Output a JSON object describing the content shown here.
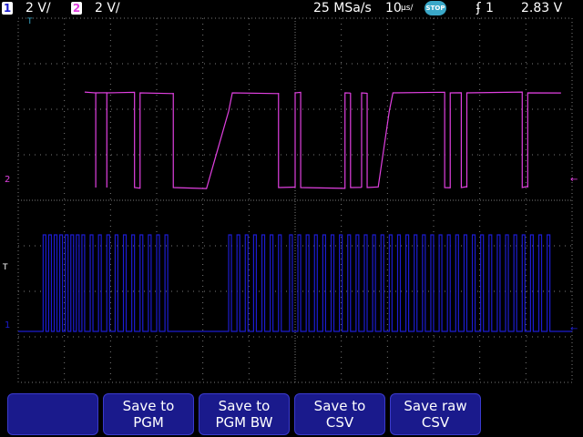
{
  "status": {
    "ch1_number": "1",
    "ch1_scale": "2 V/",
    "ch2_number": "2",
    "ch2_scale": "2 V/",
    "sample_rate": "25 MSa/s",
    "timebase": "10",
    "timebase_unit": "µs/",
    "run_state": "STOP",
    "trigger_channel": "1",
    "trigger_level": "2.83 V"
  },
  "markers": {
    "top_marker": "T",
    "ch2_marker": "2",
    "trig_marker": "T",
    "ch1_marker": "1"
  },
  "softkeys": [
    {
      "line1": "",
      "line2": ""
    },
    {
      "line1": "Save to",
      "line2": "PGM"
    },
    {
      "line1": "Save to",
      "line2": "PGM BW"
    },
    {
      "line1": "Save to",
      "line2": "CSV"
    },
    {
      "line1": "Save raw",
      "line2": "CSV"
    }
  ],
  "colors": {
    "ch1": "#1c1cd0",
    "ch2": "#e040e0",
    "grid": "#7a7a7a",
    "softkey_bg": "#1a1a8c"
  },
  "traces": {
    "ch2_segments": [
      [
        "h",
        0.12
      ],
      [
        "d",
        0.14
      ],
      [
        "l",
        0.14
      ],
      [
        "u",
        0.14
      ],
      [
        "h",
        0.16
      ],
      [
        "d",
        0.16
      ],
      [
        "l",
        0.16
      ],
      [
        "u",
        0.16
      ],
      [
        "h",
        0.21
      ],
      [
        "d",
        0.21
      ],
      [
        "l",
        0.22
      ],
      [
        "u",
        0.22
      ],
      [
        "h",
        0.28
      ],
      [
        "d",
        0.28
      ],
      [
        "l",
        0.34
      ],
      [
        "r",
        0.38
      ],
      [
        "h",
        0.47
      ],
      [
        "d",
        0.47
      ],
      [
        "l",
        0.5
      ],
      [
        "u",
        0.5
      ],
      [
        "h",
        0.51
      ],
      [
        "d",
        0.51
      ],
      [
        "l",
        0.59
      ],
      [
        "u",
        0.59
      ],
      [
        "h",
        0.6
      ],
      [
        "d",
        0.6
      ],
      [
        "l",
        0.62
      ],
      [
        "u",
        0.62
      ],
      [
        "h",
        0.63
      ],
      [
        "d",
        0.63
      ],
      [
        "l",
        0.65
      ],
      [
        "r",
        0.67
      ],
      [
        "h",
        0.77
      ],
      [
        "d",
        0.77
      ],
      [
        "l",
        0.78
      ],
      [
        "u",
        0.78
      ],
      [
        "h",
        0.8
      ],
      [
        "d",
        0.8
      ],
      [
        "l",
        0.81
      ],
      [
        "u",
        0.81
      ],
      [
        "h",
        0.91
      ],
      [
        "d",
        0.91
      ],
      [
        "l",
        0.92
      ],
      [
        "u",
        0.92
      ],
      [
        "h",
        0.98
      ]
    ],
    "ch1_pulses": [
      0.045,
      0.055,
      0.065,
      0.075,
      0.085,
      0.095,
      0.105,
      0.115,
      0.13,
      0.145,
      0.16,
      0.175,
      0.19,
      0.205,
      0.22,
      0.235,
      0.25,
      0.265,
      0.38,
      0.395,
      0.41,
      0.425,
      0.44,
      0.455,
      0.47,
      0.49,
      0.505,
      0.52,
      0.535,
      0.55,
      0.565,
      0.58,
      0.595,
      0.61,
      0.625,
      0.64,
      0.655,
      0.67,
      0.685,
      0.7,
      0.715,
      0.73,
      0.745,
      0.76,
      0.775,
      0.79,
      0.805,
      0.82,
      0.835,
      0.85,
      0.865,
      0.88,
      0.895,
      0.91,
      0.925,
      0.94,
      0.955
    ]
  }
}
